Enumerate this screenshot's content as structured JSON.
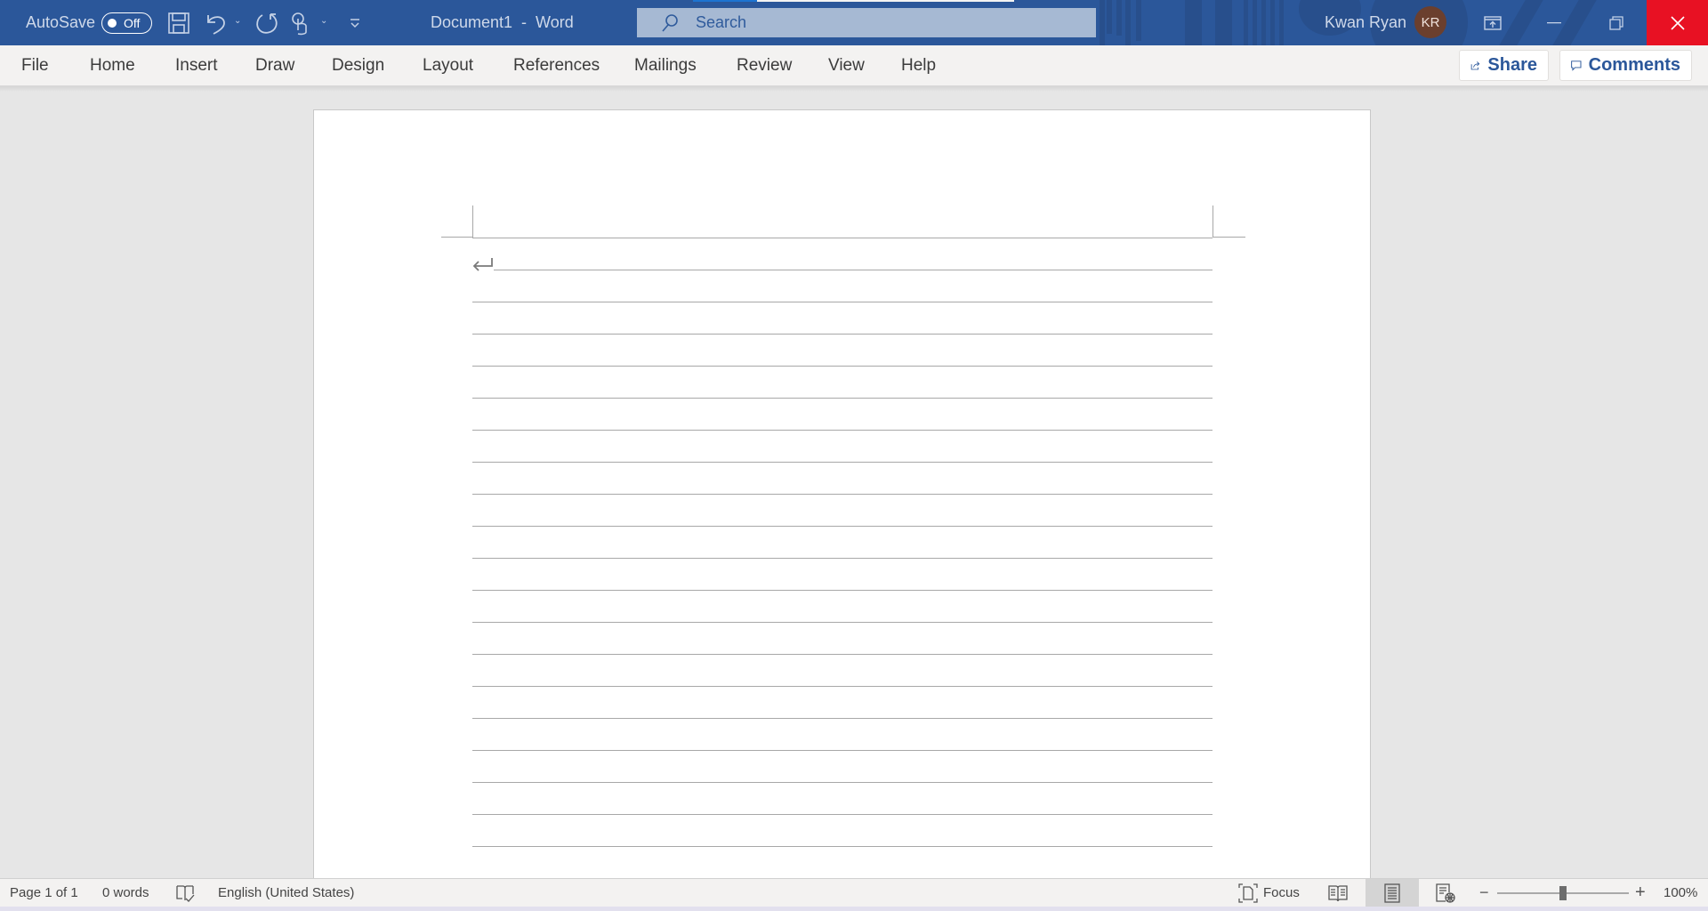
{
  "titlebar": {
    "autosave_label": "AutoSave",
    "autosave_state": "Off",
    "document_title": "Document1  -  Word",
    "search_placeholder": "Search",
    "user_name": "Kwan Ryan",
    "user_initials": "KR",
    "icons": [
      "save-icon",
      "undo-icon",
      "redo-icon",
      "touch-mode-icon",
      "customize-qat-icon",
      "ribbon-display-options-icon",
      "minimize-icon",
      "restore-icon",
      "close-icon"
    ],
    "colors": {
      "titlebar": "#2b579a",
      "close": "#e81123",
      "avatar": "#6b3f2e"
    }
  },
  "ribbon": {
    "tabs": [
      {
        "label": "File"
      },
      {
        "label": "Home"
      },
      {
        "label": "Insert"
      },
      {
        "label": "Draw"
      },
      {
        "label": "Design"
      },
      {
        "label": "Layout"
      },
      {
        "label": "References"
      },
      {
        "label": "Mailings"
      },
      {
        "label": "Review"
      },
      {
        "label": "View"
      },
      {
        "label": "Help"
      }
    ],
    "share_label": "Share",
    "comments_label": "Comments"
  },
  "document": {
    "content": "",
    "ruled_line_count": 19,
    "paragraph_mark": "↵"
  },
  "statusbar": {
    "page": "Page 1 of 1",
    "words": "0 words",
    "language": "English (United States)",
    "focus_label": "Focus",
    "active_view": "Print Layout",
    "zoom_percent": "100%",
    "zoom_value": 100
  }
}
